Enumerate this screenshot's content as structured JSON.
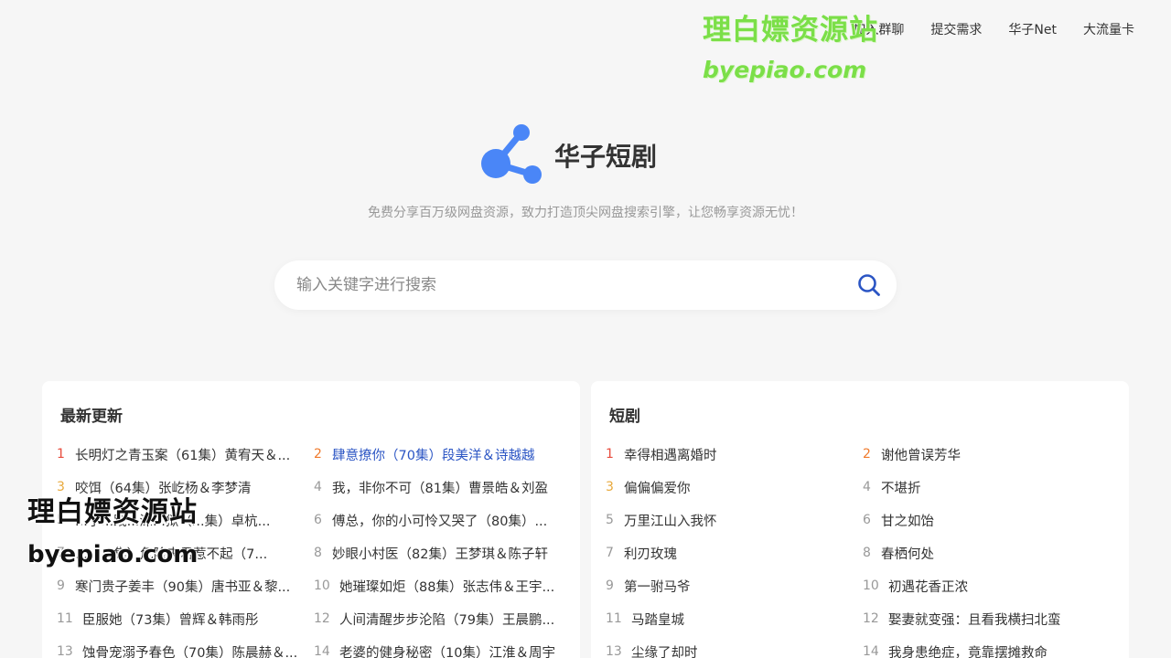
{
  "nav": {
    "items": [
      "加入群聊",
      "提交需求",
      "华子Net",
      "大流量卡"
    ]
  },
  "watermark": {
    "cn": "理白嫖资源站",
    "en": "byepiao.com"
  },
  "brand": {
    "name": "华子短剧",
    "logo_icon": "share-nodes-icon",
    "logo_color": "#4a86f7"
  },
  "slogan": "免费分享百万级网盘资源，致力打造顶尖网盘搜索引擎，让您畅享资源无忧！",
  "search": {
    "placeholder": "输入关键字进行搜索",
    "value": "",
    "icon": "search-icon",
    "icon_color": "#2b55c4"
  },
  "latest": {
    "title": "最新更新",
    "items": [
      {
        "num": "1",
        "text": "长明灯之青玉案（61集）黄宥天＆..."
      },
      {
        "num": "2",
        "text": "肆意撩你（70集）段美洋＆诗越越"
      },
      {
        "num": "3",
        "text": "咬饵（64集）张屹杨＆李梦清"
      },
      {
        "num": "4",
        "text": "我，非你不可（81集）曹景皓＆刘盈"
      },
      {
        "num": "5",
        "text": "...子...践...深...狱（...集）卓杭..."
      },
      {
        "num": "6",
        "text": "傅总，你的小可怜又哭了（80集）..."
      },
      {
        "num": "7",
        "text": "...（...集）危险夫君惹不起（7..."
      },
      {
        "num": "8",
        "text": "妙眼小村医（82集）王梦琪＆陈子轩"
      },
      {
        "num": "9",
        "text": "寒门贵子姜丰（90集）唐书亚＆黎..."
      },
      {
        "num": "10",
        "text": "她璀璨如炬（88集）张志伟＆王宇..."
      },
      {
        "num": "11",
        "text": "臣服她（73集）曾辉＆韩雨彤"
      },
      {
        "num": "12",
        "text": "人间清醒步步沦陷（79集）王晨鹏..."
      },
      {
        "num": "13",
        "text": "蚀骨宠溺予春色（70集）陈晨赫＆..."
      },
      {
        "num": "14",
        "text": "老婆的健身秘密（10集）江淮＆周宇"
      }
    ]
  },
  "shorts": {
    "title": "短剧",
    "items": [
      {
        "num": "1",
        "text": "幸得相遇离婚时"
      },
      {
        "num": "2",
        "text": "谢他曾误芳华"
      },
      {
        "num": "3",
        "text": "偏偏偏爱你"
      },
      {
        "num": "4",
        "text": "不堪折"
      },
      {
        "num": "5",
        "text": "万里江山入我怀"
      },
      {
        "num": "6",
        "text": "甘之如饴"
      },
      {
        "num": "7",
        "text": "利刃玫瑰"
      },
      {
        "num": "8",
        "text": "春栖何处"
      },
      {
        "num": "9",
        "text": "第一驸马爷"
      },
      {
        "num": "10",
        "text": "初遇花香正浓"
      },
      {
        "num": "11",
        "text": "马踏皇城"
      },
      {
        "num": "12",
        "text": "娶妻就变强：且看我横扫北蛮"
      },
      {
        "num": "13",
        "text": "尘缘了却时"
      },
      {
        "num": "14",
        "text": "我身患绝症，竟靠摆摊救命"
      }
    ]
  }
}
